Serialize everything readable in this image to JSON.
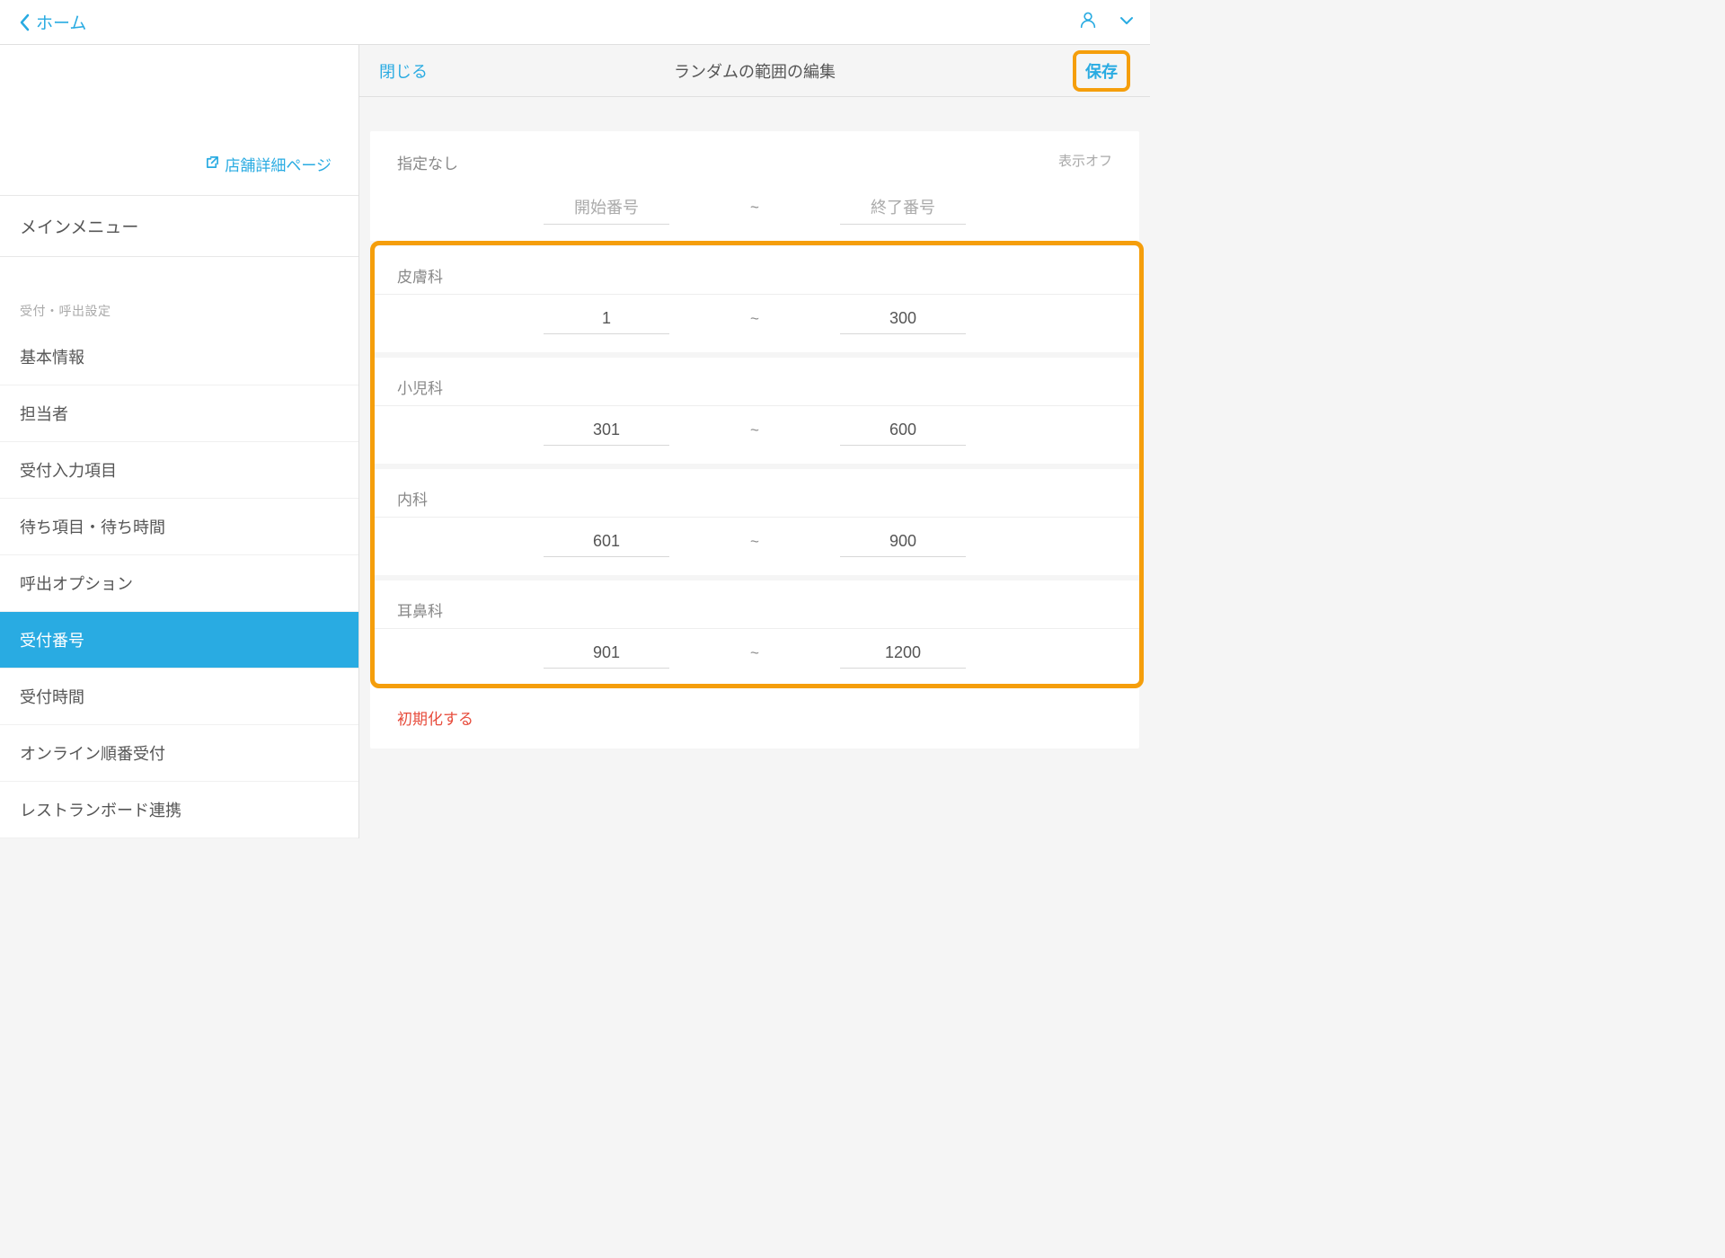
{
  "header": {
    "back_label": "ホーム"
  },
  "sidebar": {
    "store_detail_link": "店舗詳細ページ",
    "main_menu_label": "メインメニュー",
    "section_header": "受付・呼出設定",
    "items": [
      {
        "label": "基本情報"
      },
      {
        "label": "担当者"
      },
      {
        "label": "受付入力項目"
      },
      {
        "label": "待ち項目・待ち時間"
      },
      {
        "label": "呼出オプション"
      },
      {
        "label": "受付番号"
      },
      {
        "label": "受付時間"
      },
      {
        "label": "オンライン順番受付"
      },
      {
        "label": "レストランボード連携"
      }
    ]
  },
  "panel": {
    "close_label": "閉じる",
    "title": "ランダムの範囲の編集",
    "save_label": "保存",
    "unspecified_label": "指定なし",
    "display_off_label": "表示オフ",
    "start_placeholder": "開始番号",
    "end_placeholder": "終了番号",
    "tilde": "~",
    "categories": [
      {
        "label": "皮膚科",
        "start": "1",
        "end": "300"
      },
      {
        "label": "小児科",
        "start": "301",
        "end": "600"
      },
      {
        "label": "内科",
        "start": "601",
        "end": "900"
      },
      {
        "label": "耳鼻科",
        "start": "901",
        "end": "1200"
      }
    ],
    "reset_label": "初期化する"
  }
}
